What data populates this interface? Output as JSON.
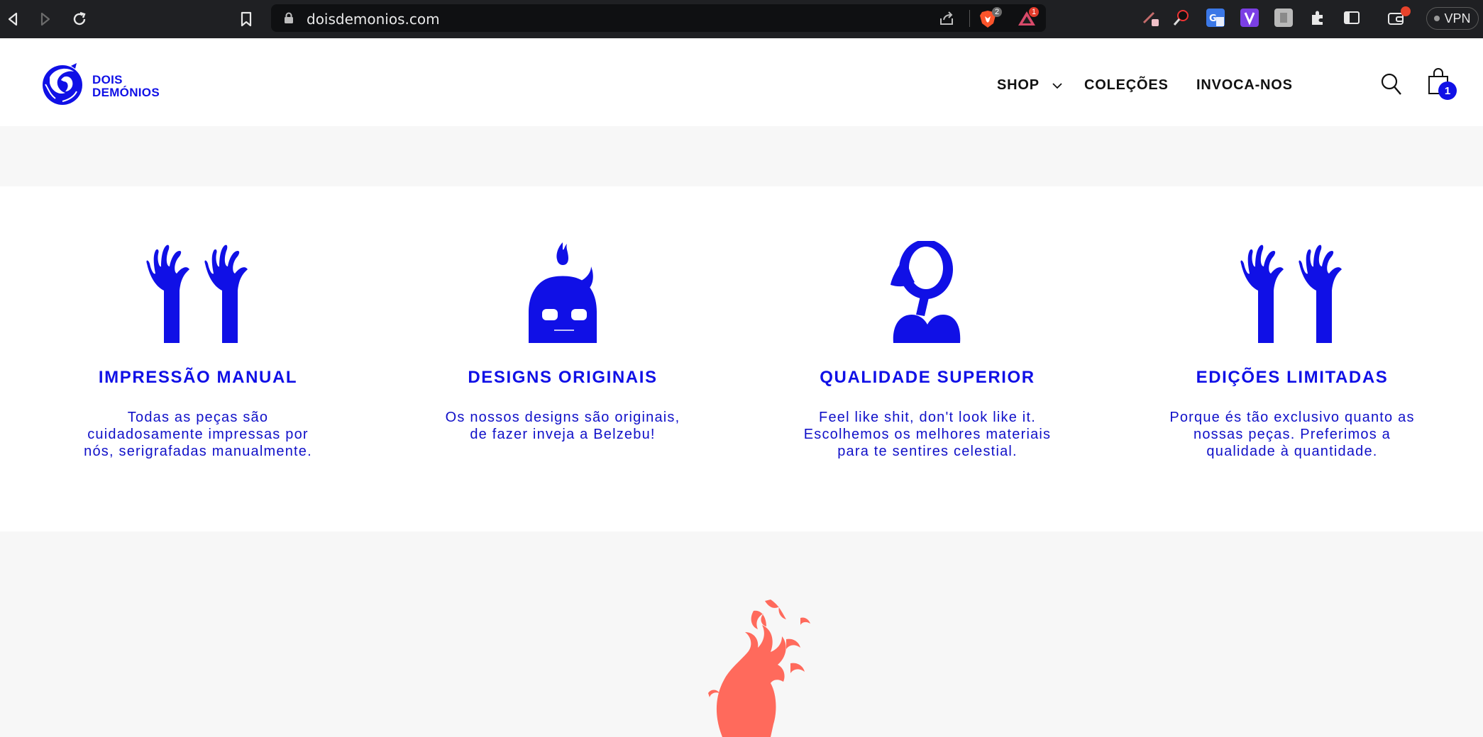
{
  "browser": {
    "url": "doisdemonios.com",
    "brave_badge": "2",
    "rewards_badge": "1",
    "vpn_label": "VPN"
  },
  "header": {
    "logo_line1": "DOIS",
    "logo_line2": "DEMÓNIOS",
    "nav": {
      "shop": "SHOP",
      "collections": "COLEÇÕES",
      "contact": "INVOCA-NOS"
    },
    "cart_count": "1"
  },
  "features": [
    {
      "title": "IMPRESSÃO MANUAL",
      "line1": "Todas as peças são",
      "line2": "cuidadosamente impressas por",
      "line3": "nós, serigrafadas manualmente."
    },
    {
      "title": "DESIGNS ORIGINAIS",
      "line1": "Os nossos designs são originais,",
      "line2": "de fazer inveja a Belzebu!",
      "line3": ""
    },
    {
      "title": "QUALIDADE SUPERIOR",
      "line1": "Feel like shit, don't look like it.",
      "line2": "Escolhemos os melhores materiais",
      "line3": "para te sentires celestial."
    },
    {
      "title": "EDIÇÕES LIMITADAS",
      "line1": "Porque és tão exclusivo quanto as",
      "line2": "nossas peças. Preferimos a",
      "line3": "qualidade à quantidade."
    }
  ],
  "colors": {
    "brand_blue": "#1010e6",
    "flame_coral": "#ff6a5c",
    "chrome_dark": "#1f2023"
  }
}
